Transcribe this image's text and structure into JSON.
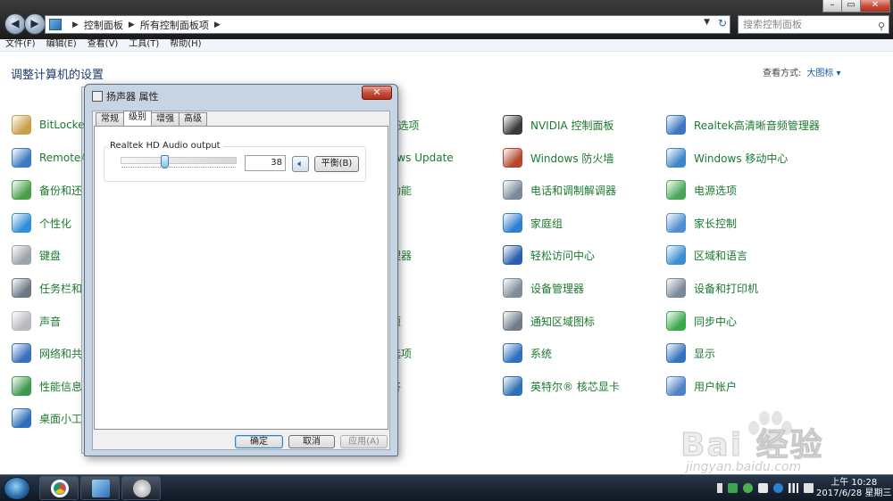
{
  "breadcrumb": [
    "控制面板",
    "所有控制面板项"
  ],
  "search_placeholder": "搜索控制面板",
  "window_controls": [
    "–",
    "▭",
    "✕"
  ],
  "menu": [
    "文件(F)",
    "编辑(E)",
    "查看(V)",
    "工具(T)",
    "帮助(H)"
  ],
  "header": {
    "title": "调整计算机的设置",
    "view_by_label": "查看方式:",
    "view_by_value": "大图标 ▾"
  },
  "items": {
    "col1": [
      "BitLocke",
      "RemoteA",
      "备份和还",
      "个性化",
      "键盘",
      "任务栏和",
      "声音",
      "网络和共",
      "性能信息",
      "桌面小工"
    ],
    "col2_partial": [
      "t 选项",
      "ows Update",
      "功能",
      "",
      "理器",
      "",
      "项",
      "选项",
      "答"
    ],
    "col3": [
      "NVIDIA 控制面板",
      "Windows 防火墙",
      "电话和调制解调器",
      "家庭组",
      "轻松访问中心",
      "设备管理器",
      "通知区域图标",
      "系统",
      "英特尔® 核芯显卡"
    ],
    "col4": [
      "Realtek高清晰音频管理器",
      "Windows 移动中心",
      "电源选项",
      "家长控制",
      "区域和语言",
      "设备和打印机",
      "同步中心",
      "显示",
      "用户帐户"
    ],
    "icon_colors": {
      "col1": [
        "#c8a04a",
        "#3c78c3",
        "#4aa04a",
        "#2e8fd8",
        "#9aa2ab",
        "#6b7785",
        "#b8b8c0",
        "#3a6fc0",
        "#3d9a4d",
        "#2d6fb8"
      ],
      "col3": [
        "#3a3a3a",
        "#b5462b",
        "#7a8a99",
        "#2f7fd1",
        "#2a5fb0",
        "#7f8c99",
        "#6f7d8b",
        "#2f6fc0",
        "#2f6fb4"
      ],
      "col4": [
        "#3c75c0",
        "#3f86c9",
        "#4aa55a",
        "#4f8ed2",
        "#3a8fd0",
        "#7a8898",
        "#3ba84a",
        "#3572bf",
        "#4f82c6"
      ]
    }
  },
  "dialog": {
    "title": "扬声器 属性",
    "close": "✕",
    "tabs": [
      "常规",
      "级别",
      "增强",
      "高级"
    ],
    "device_name": "Realtek HD Audio output",
    "volume_value": "38",
    "volume_level": 0.38,
    "mute_icon": "speaker-icon",
    "balance_button": "平衡(B)",
    "ok_button": "确定",
    "cancel_button": "取消",
    "apply_button": "应用(A)"
  },
  "taskbar": {
    "clock_time": "上午 10:28",
    "clock_date": "2017/6/28 星期三"
  },
  "watermark": {
    "brand": "Bai 经验",
    "url": "jingyan.baidu.com"
  }
}
